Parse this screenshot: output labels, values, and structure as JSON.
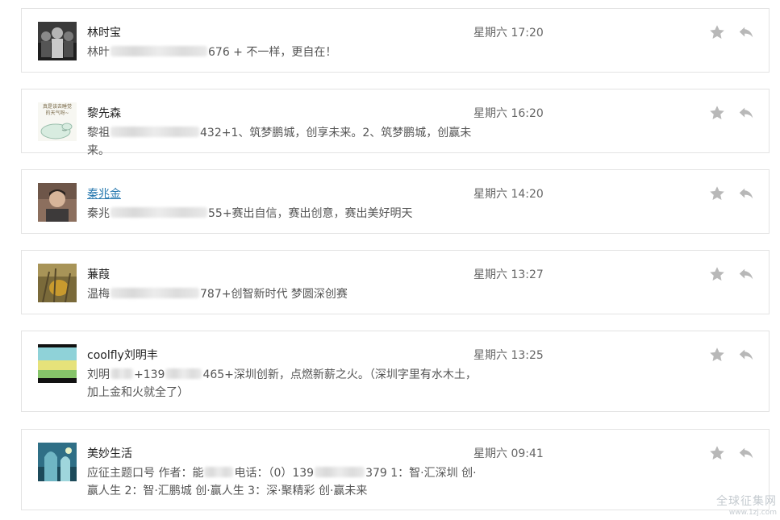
{
  "messages": [
    {
      "sender": "林时宝",
      "time": "星期六 17:20",
      "parts": [
        "林旪",
        "",
        "676 + 不一样，更自在！"
      ],
      "blur_widths": [
        0,
        120
      ]
    },
    {
      "sender": "黎先森",
      "time": "星期六 16:20",
      "avatar_text": [
        "真是该去睡觉",
        "的天气呀~"
      ],
      "parts": [
        "黎祖",
        "",
        "432+1、筑梦鹏城，创享未来。2、筑梦鹏城，创赢未来。"
      ],
      "blur_widths": [
        0,
        110
      ]
    },
    {
      "sender": "秦兆金",
      "time": "星期六 14:20",
      "parts": [
        "秦兆",
        "",
        "55+赛出自信，赛出创意，赛出美好明天"
      ],
      "blur_widths": [
        0,
        120
      ]
    },
    {
      "sender": "蒹葭",
      "time": "星期六 13:27",
      "parts": [
        "温梅",
        "",
        "787+创智新时代 梦圆深创赛"
      ],
      "blur_widths": [
        0,
        110
      ]
    },
    {
      "sender": "coolfly刘明丰",
      "time": "星期六 13:25",
      "parts": [
        "刘明",
        "",
        "+139",
        "",
        "465+深圳创新，点燃新薪之火。（深圳字里有水木土，加上金和火就全了）"
      ],
      "blur_widths": [
        0,
        28,
        0,
        45
      ]
    },
    {
      "sender": "美妙生活",
      "time": "星期六 09:41",
      "parts": [
        "应征主题口号 作者：能",
        "",
        "电话：（0）139",
        "",
        "379 1：智·汇深圳 创·赢人生 2：智·汇鹏城 创·赢人生 3：深·聚精彩 创·赢未来"
      ],
      "blur_widths": [
        0,
        36,
        0,
        62
      ]
    }
  ],
  "watermark": {
    "line1": "全球征集网",
    "line2": "www.1zj.com"
  },
  "icons": {
    "star": "star-icon",
    "reply": "reply-icon"
  }
}
